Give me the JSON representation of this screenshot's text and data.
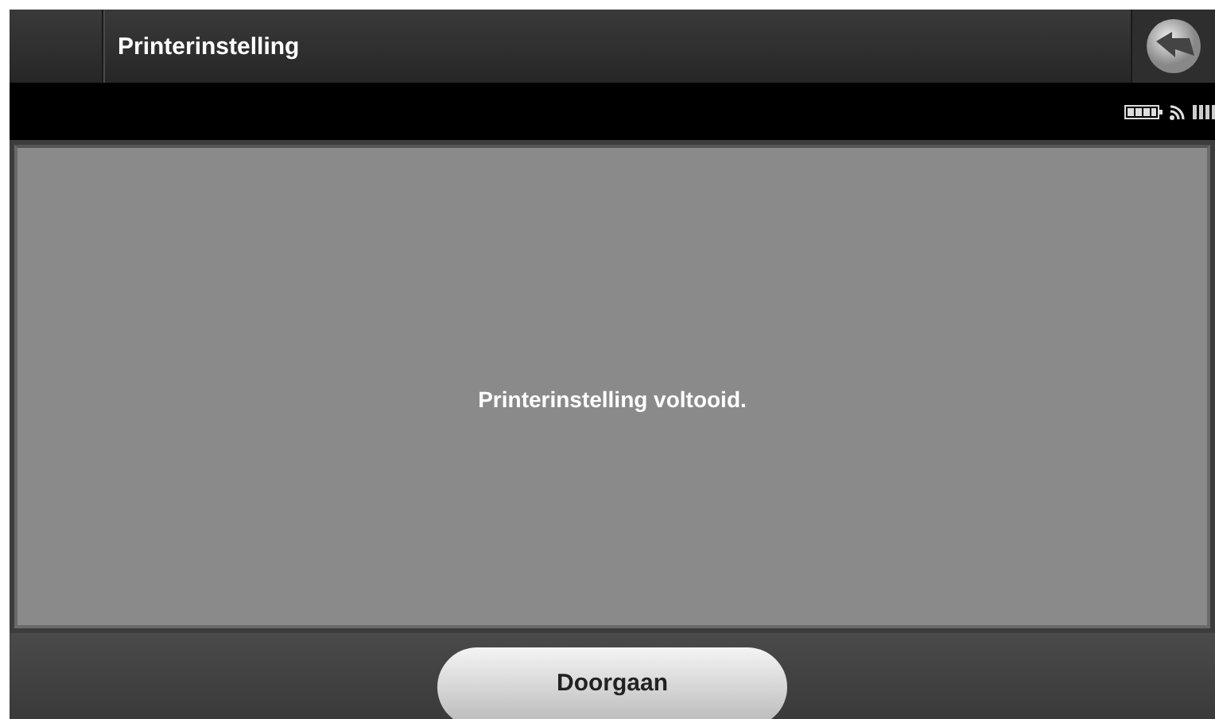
{
  "header": {
    "title": "Printerinstelling"
  },
  "message": "Printerinstelling voltooid.",
  "buttons": [
    "Doorgaan"
  ]
}
